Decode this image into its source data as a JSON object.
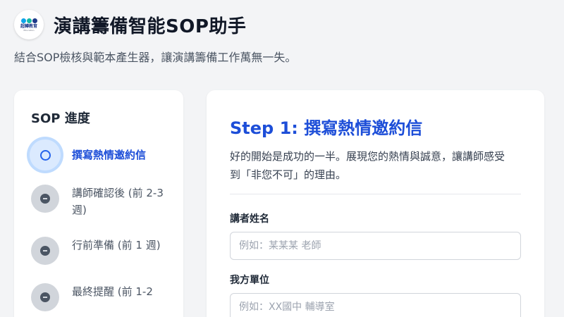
{
  "header": {
    "logo": {
      "text": "超轉教育",
      "sub": "Education"
    },
    "title": "演講籌備智能SOP助手",
    "subtitle": "結合SOP檢核與範本產生器，讓演講籌備工作萬無一失。"
  },
  "sidebar": {
    "title": "SOP 進度",
    "steps": [
      {
        "label": "撰寫熱情邀約信",
        "state": "active"
      },
      {
        "label": "講師確認後 (前 2-3 週)",
        "state": "pending"
      },
      {
        "label": "行前準備 (前 1 週)",
        "state": "pending"
      },
      {
        "label": "最終提醒 (前 1-2",
        "state": "pending"
      }
    ]
  },
  "main": {
    "title": "Step 1: 撰寫熱情邀約信",
    "description": "好的開始是成功的一半。展現您的熱情與誠意，讓講師感受到「非您不可」的理由。",
    "fields": [
      {
        "label": "講者姓名",
        "placeholder": "例如：某某某 老師",
        "value": ""
      },
      {
        "label": "我方單位",
        "placeholder": "例如：XX國中 輔導室",
        "value": ""
      }
    ]
  }
}
